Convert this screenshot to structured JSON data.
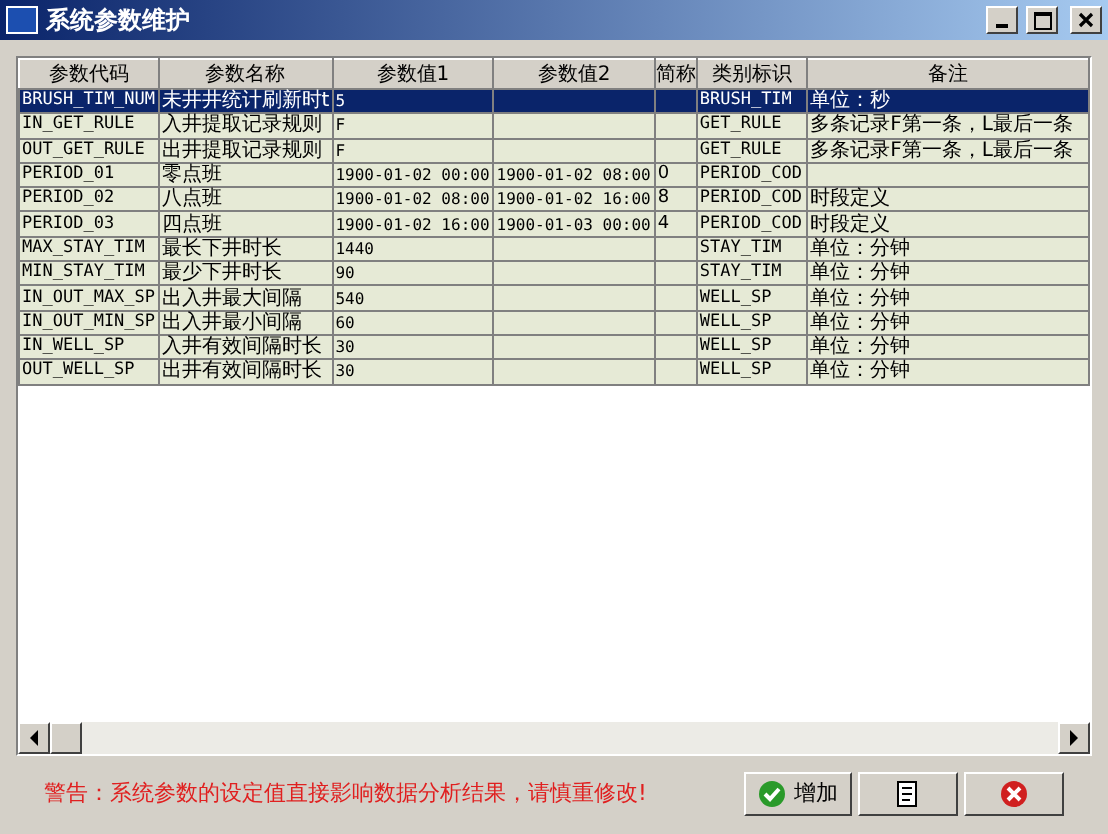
{
  "window": {
    "title": "系统参数维护"
  },
  "table": {
    "columns": [
      "参数代码",
      "参数名称",
      "参数值1",
      "参数值2",
      "简称",
      "类别标识",
      "备注"
    ],
    "rows": [
      {
        "selected": true,
        "cells": [
          "BRUSH_TIM_NUM",
          "未井井统计刷新时t",
          "5",
          "",
          "",
          "BRUSH_TIM",
          "单位：秒"
        ]
      },
      {
        "selected": false,
        "cells": [
          "IN_GET_RULE",
          "入井提取记录规则",
          "F",
          "",
          "",
          "GET_RULE",
          "多条记录F第一条，L最后一条"
        ]
      },
      {
        "selected": false,
        "cells": [
          "OUT_GET_RULE",
          "出井提取记录规则",
          "F",
          "",
          "",
          "GET_RULE",
          "多条记录F第一条，L最后一条"
        ]
      },
      {
        "selected": false,
        "cells": [
          "PERIOD_01",
          "零点班",
          "1900-01-02 00:00",
          "1900-01-02 08:00",
          "0",
          "PERIOD_COD",
          ""
        ]
      },
      {
        "selected": false,
        "cells": [
          "PERIOD_02",
          "八点班",
          "1900-01-02 08:00",
          "1900-01-02 16:00",
          "8",
          "PERIOD_COD",
          "时段定义"
        ]
      },
      {
        "selected": false,
        "cells": [
          "PERIOD_03",
          "四点班",
          "1900-01-02 16:00",
          "1900-01-03 00:00",
          "4",
          "PERIOD_COD",
          "时段定义"
        ]
      },
      {
        "selected": false,
        "cells": [
          "MAX_STAY_TIM",
          "最长下井时长",
          "1440",
          "",
          "",
          "STAY_TIM",
          "单位：分钟"
        ]
      },
      {
        "selected": false,
        "cells": [
          "MIN_STAY_TIM",
          "最少下井时长",
          "90",
          "",
          "",
          "STAY_TIM",
          "单位：分钟"
        ]
      },
      {
        "selected": false,
        "cells": [
          "IN_OUT_MAX_SP",
          "出入井最大间隔",
          "540",
          "",
          "",
          "WELL_SP",
          "单位：分钟"
        ]
      },
      {
        "selected": false,
        "cells": [
          "IN_OUT_MIN_SP",
          "出入井最小间隔",
          "60",
          "",
          "",
          "WELL_SP",
          "单位：分钟"
        ]
      },
      {
        "selected": false,
        "cells": [
          "IN_WELL_SP",
          "入井有效间隔时长",
          "30",
          "",
          "",
          "WELL_SP",
          "单位：分钟"
        ]
      },
      {
        "selected": false,
        "cells": [
          "OUT_WELL_SP",
          "出井有效间隔时长",
          "30",
          "",
          "",
          "WELL_SP",
          "单位：分钟"
        ]
      }
    ]
  },
  "warning": "警告：系统参数的设定值直接影响数据分析结果，请慎重修改!",
  "buttons": [
    {
      "kind": "add",
      "label": "增加"
    },
    {
      "kind": "edit"
    },
    {
      "kind": "delete"
    }
  ]
}
